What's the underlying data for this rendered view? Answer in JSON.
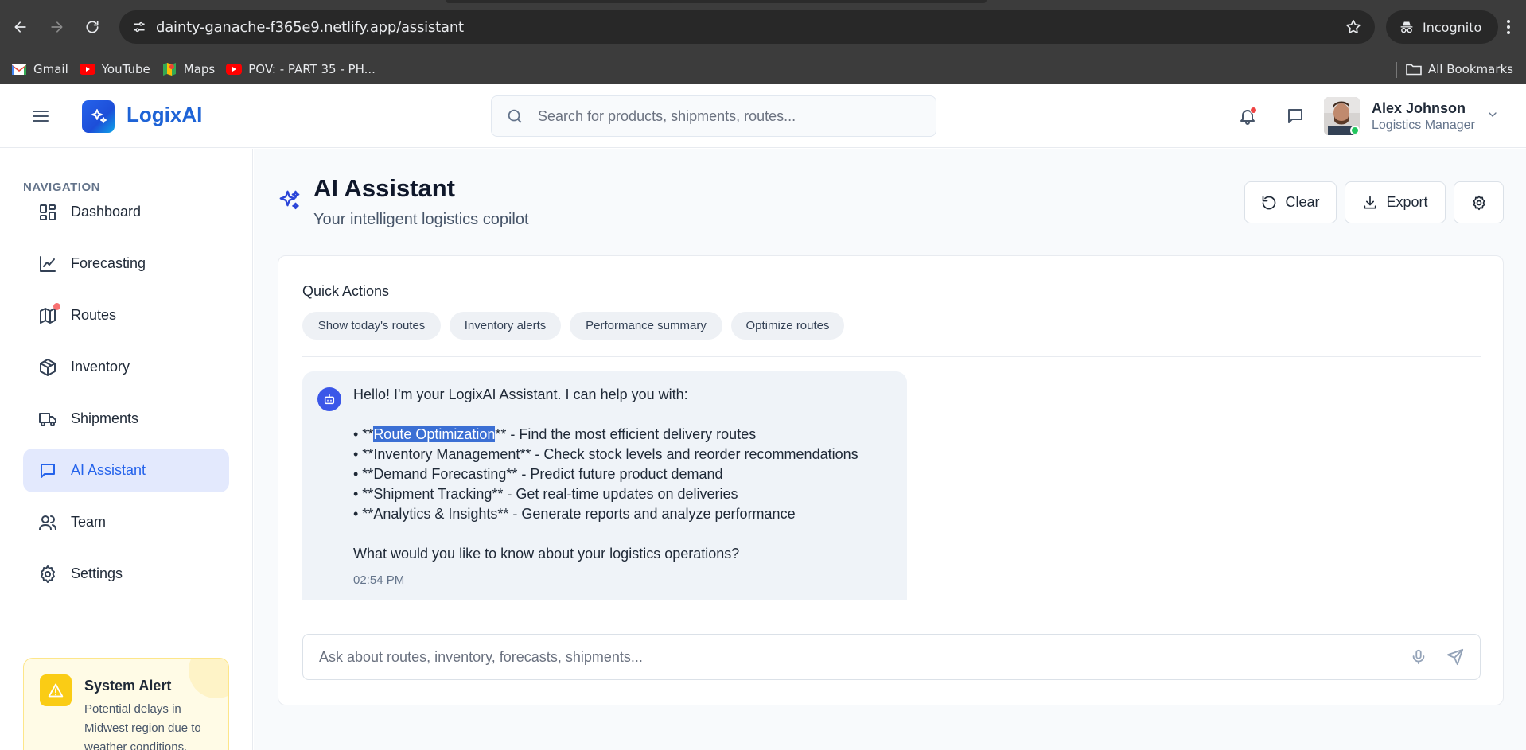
{
  "browser": {
    "url": "dainty-ganache-f365e9.netlify.app/assistant",
    "incognito_label": "Incognito",
    "bookmarks": [
      {
        "label": "Gmail",
        "icon": "gmail-icon"
      },
      {
        "label": "YouTube",
        "icon": "youtube-icon"
      },
      {
        "label": "Maps",
        "icon": "maps-icon"
      },
      {
        "label": "POV: - PART 35 - PH...",
        "icon": "youtube-icon"
      }
    ],
    "all_bookmarks_label": "All Bookmarks"
  },
  "header": {
    "brand": "LogixAI",
    "search_placeholder": "Search for products, shipments, routes...",
    "user": {
      "name": "Alex Johnson",
      "role": "Logistics Manager"
    }
  },
  "sidebar": {
    "heading": "NAVIGATION",
    "items": [
      {
        "label": "Dashboard",
        "icon": "dashboard-icon"
      },
      {
        "label": "Forecasting",
        "icon": "chart-line-icon"
      },
      {
        "label": "Routes",
        "icon": "map-icon"
      },
      {
        "label": "Inventory",
        "icon": "package-icon"
      },
      {
        "label": "Shipments",
        "icon": "truck-icon"
      },
      {
        "label": "AI Assistant",
        "icon": "message-square-icon",
        "active": true
      },
      {
        "label": "Team",
        "icon": "users-icon"
      },
      {
        "label": "Settings",
        "icon": "gear-icon"
      }
    ],
    "alert": {
      "title": "System Alert",
      "text": "Potential delays in Midwest region due to weather conditions."
    }
  },
  "main": {
    "title": "AI Assistant",
    "subtitle": "Your intelligent logistics copilot",
    "buttons": {
      "clear": "Clear",
      "export": "Export"
    },
    "quick_actions": {
      "title": "Quick Actions",
      "chips": [
        "Show today's routes",
        "Inventory alerts",
        "Performance summary",
        "Optimize routes"
      ]
    },
    "message": {
      "intro": "Hello! I'm your LogixAI Assistant. I can help you with:",
      "bullet1_prefix": "• **",
      "bullet1_highlight": "Route Optimization",
      "bullet1_suffix": "** - Find the most efficient delivery routes",
      "bullet2": "• **Inventory Management** - Check stock levels and reorder recommendations",
      "bullet3": "• **Demand Forecasting** - Predict future product demand",
      "bullet4": "• **Shipment Tracking** - Get real-time updates on deliveries",
      "bullet5": "• **Analytics & Insights** - Generate reports and analyze performance",
      "question": "What would you like to know about your logistics operations?",
      "time": "02:54 PM"
    },
    "composer_placeholder": "Ask about routes, inventory, forecasts, shipments..."
  },
  "colors": {
    "accent": "#2563eb",
    "active_nav_bg": "#e3e9fd",
    "alert_bg": "#fffbe6",
    "alert_icon": "#facc15",
    "notification_dot": "#ef4444",
    "online": "#22c55e"
  }
}
